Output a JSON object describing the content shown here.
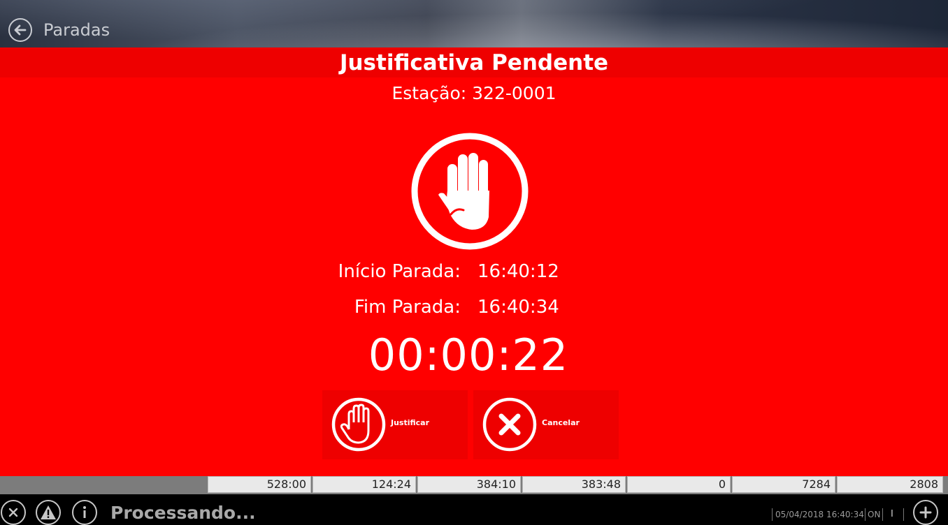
{
  "header": {
    "title": "Paradas"
  },
  "modal": {
    "title": "Justificativa Pendente",
    "station": "Estação: 322-0001",
    "start_label": "Início Parada:",
    "start_value": "16:40:12",
    "end_label": "Fim Parada:",
    "end_value": "16:40:34",
    "duration": "00:00:22",
    "buttons": {
      "justify_label": "Justificar",
      "cancel_label": "Cancelar"
    },
    "icon": "stop-hand-icon"
  },
  "table": {
    "row": [
      "528:00",
      "124:24",
      "384:10",
      "383:48",
      "0",
      "7284",
      "2808"
    ]
  },
  "status_bar": {
    "text": "Processando...",
    "datetime": "05/04/2018 16:40:34",
    "on": "ON",
    "indicator": "I"
  },
  "colors": {
    "modal_background": "#ff0000",
    "title_bar": "#ee0000",
    "button_background": "#ee0000"
  }
}
